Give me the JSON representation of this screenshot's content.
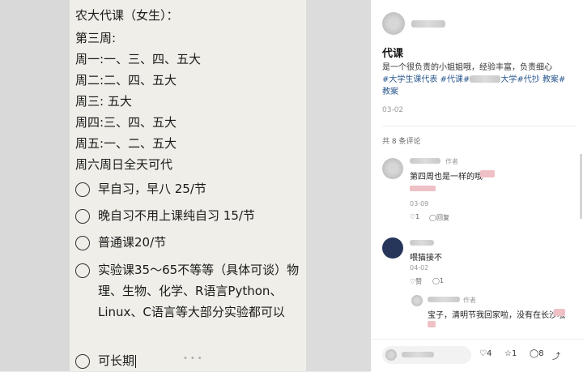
{
  "note": {
    "title": "农大代课（女生）：",
    "week": "第三周:",
    "days": [
      "周一:一、三、四、五大",
      "周二:二、四、五大",
      "周三: 五大",
      "周四:三、四、五大",
      "周五:一、二、五大",
      "周六周日全天可代"
    ],
    "options": [
      "早自习，早八 25/节",
      "晚自习不用上课纯自习 15/节",
      "普通课20/节",
      "实验课35～65不等等（具体可谈）物理、生物、化学、R语言Python、Linux、C语言等大部分实验都可以",
      "可长期"
    ]
  },
  "post": {
    "title": "代课",
    "desc_line1": "是一个很负责的小姐姐哦，经验丰富，负责细心",
    "tag_prefix": "#大学生课代表 #代课#",
    "tag_suffix": "大学#代抄 教案#",
    "tag_line3": "教案",
    "date": "03-02",
    "comment_count": "共 8 条评论",
    "comments": [
      {
        "author_badge": "作者",
        "text": "第四周也是一样的哦",
        "date": "03-09",
        "likes": "1",
        "reply": "回复"
      },
      {
        "text": "喂猫接不",
        "date": "04-02",
        "like_label": "赞",
        "replies": "1"
      },
      {
        "author_badge": "作者",
        "text": "宝子，清明节我回家啦，没有在长沙哦"
      }
    ],
    "bottom": {
      "likes": "4",
      "stars": "1",
      "comments": "8"
    }
  }
}
